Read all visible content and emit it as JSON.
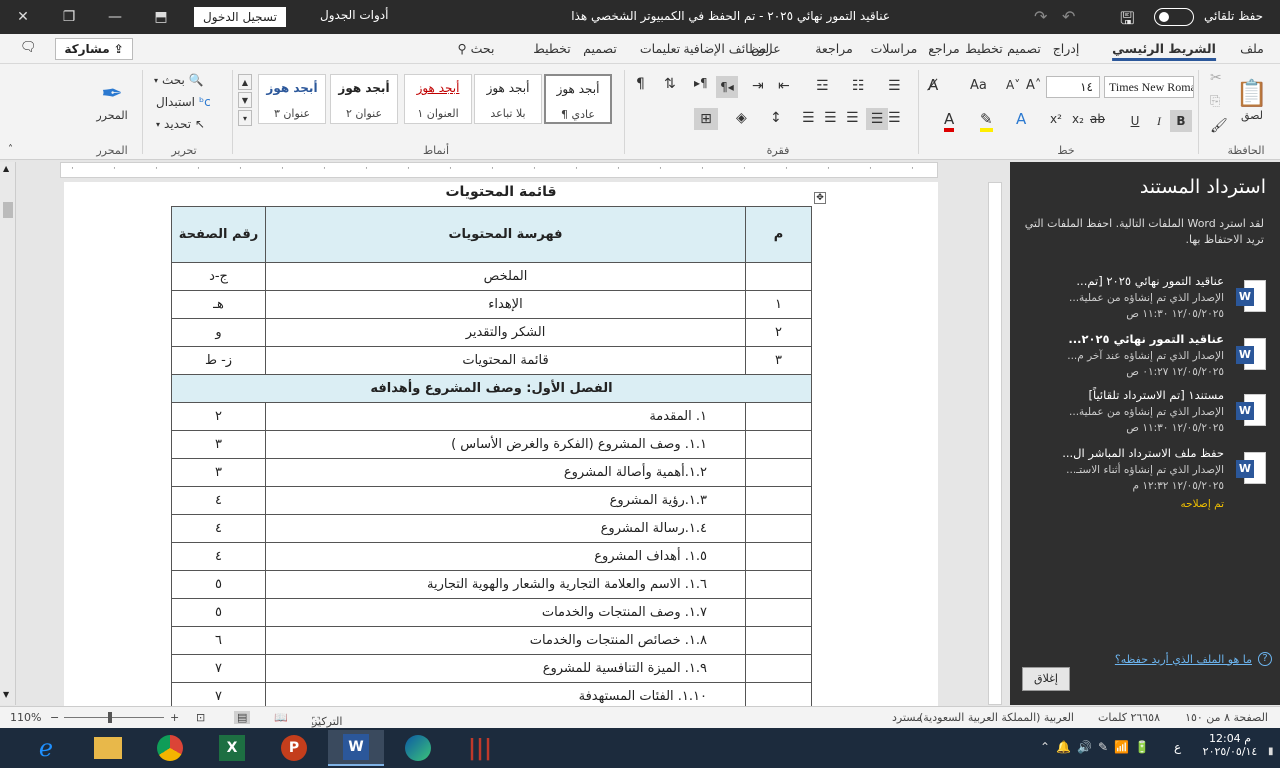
{
  "title_bar": {
    "doc_title": "عناقيد التمور نهائي ٢٠٢٥ - تم الحفظ في الكمبيوتر الشخصي هذا",
    "autosave_label": "حفظ تلقائي",
    "signin_label": "تسجيل الدخول",
    "table_tools_label": "أدوات الجدول"
  },
  "ribbon_tabs": [
    "ملف",
    "الشريط الرئيسي",
    "إدراج",
    "تصميم",
    "تخطيط",
    "مراجع",
    "مراسلات",
    "مراجعة",
    "عرض",
    "الوظائف الإضافية",
    "تعليمات",
    "تصميم",
    "تخطيط",
    "بحث"
  ],
  "share_label": "مشاركة",
  "ribbon": {
    "clipboard": {
      "label": "الحافظة",
      "paste": "لصق"
    },
    "font": {
      "label": "خط",
      "name": "Times New Roman",
      "size": "١٤",
      "aa": "Aa",
      "bold": "B",
      "italic": "I",
      "underline": "U"
    },
    "paragraph": {
      "label": "فقرة"
    },
    "styles": {
      "label": "أنماط",
      "items": [
        {
          "sample": "أبجد هوز",
          "name": "¶ عادي"
        },
        {
          "sample": "أبجد هوز",
          "name": "بلا تباعد"
        },
        {
          "sample": "أبجد هوز",
          "name": "العنوان ١"
        },
        {
          "sample": "أبجد هوز",
          "name": "عنوان ٢"
        },
        {
          "sample": "أبجد هوز",
          "name": "عنوان ٣"
        }
      ]
    },
    "editing": {
      "label": "تحرير",
      "find": "بحث",
      "replace": "استبدال",
      "select": "تحديد"
    },
    "editor": {
      "label": "المحرر",
      "button": "المحرر"
    }
  },
  "document": {
    "heading": "قائمة المحتويات",
    "table_header": {
      "num": "م",
      "title": "فهرسة المحتويات",
      "page": "رقم الصفحة"
    },
    "rows": [
      {
        "num": "",
        "title": "الملخص",
        "page": "ج-د",
        "align": "center"
      },
      {
        "num": "١",
        "title": "الإهداء",
        "page": "هـ",
        "align": "center"
      },
      {
        "num": "٢",
        "title": "الشكر والتقدير",
        "page": "و",
        "align": "center"
      },
      {
        "num": "٣",
        "title": "قائمة المحتويات",
        "page": "ز- ط",
        "align": "center"
      }
    ],
    "chapter": "الفصل الأول: وصف المشروع وأهدافه",
    "chapter_rows": [
      {
        "title": "١.   المقدمة",
        "page": "٢"
      },
      {
        "title": "١.١. وصف المشروع  (الفكرة والغرض الأساس )",
        "page": "٣"
      },
      {
        "title": "١.٢.أهمية وأصالة المشروع",
        "page": "٣"
      },
      {
        "title": "١.٣.رؤية  المشروع",
        "page": "٤"
      },
      {
        "title": "١.٤.رسالة  المشروع",
        "page": "٤"
      },
      {
        "title": "١.٥. أهداف المشروع",
        "page": "٤"
      },
      {
        "title": "١.٦.  الاسم والعلامة التجارية والشعار والهوية التجارية",
        "page": "٥"
      },
      {
        "title": "١.٧.  وصف المنتجات والخدمات",
        "page": "٥"
      },
      {
        "title": "١.٨.  خصائص المنتجات والخدمات",
        "page": "٦"
      },
      {
        "title": "١.٩.    الميزة التنافسية للمشروع",
        "page": "٧"
      },
      {
        "title": "١.١٠.    الفئات المستهدفة",
        "page": "٧"
      }
    ]
  },
  "recovery_panel": {
    "title": "استرداد المستند",
    "description": "لقد استرد Word الملفات التالية. احفظ الملفات التي تريد الاحتفاظ بها.",
    "items": [
      {
        "name": "عناقيد التمور نهائي ٢٠٢٥  [تم...",
        "desc": "الإصدار الذي تم إنشاؤه من عملية...",
        "time": "١٢/٠٥/٢٠٢٥ ١١:٣٠ ص",
        "bold": false
      },
      {
        "name": "عناقيد التمور نهائي ٢٠٢٥...",
        "desc": "الإصدار الذي تم إنشاؤه عند آخر م...",
        "time": "١٢/٠٥/٢٠٢٥ ٠١:٢٧ ص",
        "bold": true
      },
      {
        "name": "مستند١  [تم الاسترداد تلقائياً]",
        "desc": "الإصدار الذي تم إنشاؤه من عملية...",
        "time": "١٢/٠٥/٢٠٢٥ ١١:٣٠ ص",
        "bold": false
      },
      {
        "name": "حفظ ملف الاسترداد المباشر ال...",
        "desc": "الإصدار الذي تم إنشاؤه أثناء الاستـ...",
        "time": "١٢/٠٥/٢٠٢٥ ١٢:٣٢ م",
        "bold": false
      }
    ],
    "repaired": "تم إصلاحه",
    "which_file_link": "ما هو الملف الذي أريد حفظه؟",
    "close_button": "إغلاق"
  },
  "status_bar": {
    "page": "الصفحة ٨ من ١٥٠",
    "words": "٢٦٦٥٨ كلمات",
    "language": "العربية (المملكة العربية السعودية)",
    "recovered": "مسترد",
    "focus": "التركيز",
    "zoom": "110%"
  },
  "taskbar": {
    "time": "12:04 م",
    "date": "٢٠٢٥/٠٥/١٤",
    "lang": "ع"
  },
  "colors": {
    "word_blue": "#2b579a",
    "table_header_bg": "#dbeef4",
    "panel_bg": "#2f2f2f",
    "repaired": "#f0c000",
    "link": "#6cb4ee"
  }
}
